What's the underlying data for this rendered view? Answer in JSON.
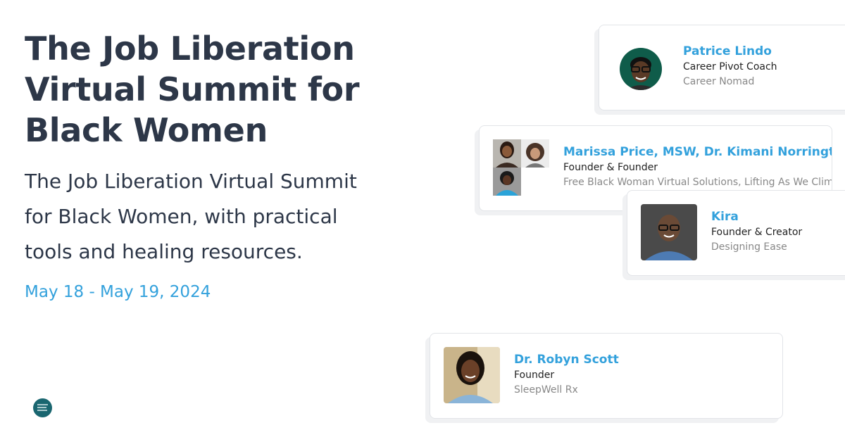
{
  "summit": {
    "title": "The Job Liberation Virtual Summit for Black Women",
    "description": "The Job Liberation Virtual Summit for Black Women, with practical tools and healing resources.",
    "dates": "May 18 - May 19, 2024"
  },
  "speakers": [
    {
      "name": "Patrice Lindo",
      "role": "Career Pivot Coach",
      "org": "Career Nomad"
    },
    {
      "name": "Marissa Price, MSW, Dr. Kimani Norrington-Sands",
      "role": "Founder & Founder",
      "org": "Free Black Woman Virtual Solutions, Lifting As We Climb Consulting"
    },
    {
      "name": "Kira",
      "role": "Founder & Creator",
      "org": "Designing Ease"
    },
    {
      "name": "Dr. Robyn Scott",
      "role": "Founder",
      "org": "SleepWell Rx"
    }
  ],
  "colors": {
    "accent": "#33a1dc",
    "heading": "#2d3748"
  }
}
